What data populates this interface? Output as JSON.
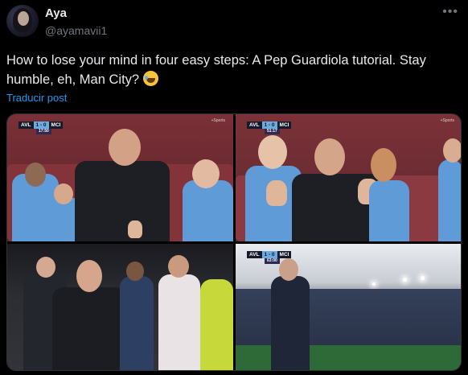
{
  "post": {
    "author_name": "Aya",
    "author_handle": "@ayamavii1",
    "more_icon": "more-dots-icon",
    "text": "How to lose your mind in four easy steps: A Pep Guardiola tutorial. Stay humble, eh, Man City?",
    "emoji": "face-with-tears-of-joy-emoji",
    "translate_link": "Traducir post"
  },
  "media": {
    "images": [
      {
        "scoreboard": {
          "home": "AVL",
          "score": "1 - 0",
          "away": "MCI",
          "clock": "17:50"
        },
        "corner_logo": "+Sports"
      },
      {
        "scoreboard": {
          "home": "AVL",
          "score": "1 - 0",
          "away": "MCI",
          "clock": "51:17"
        },
        "corner_logo": "+Sports"
      },
      {},
      {
        "scoreboard": {
          "home": "AVL",
          "score": "1 - 0",
          "away": "MCI",
          "clock": "63:00"
        }
      }
    ]
  },
  "colors": {
    "background": "#000000",
    "text_primary": "#e7e9ea",
    "text_secondary": "#71767b",
    "link": "#1d9bf0",
    "city_sky_blue": "#6cabdd"
  }
}
